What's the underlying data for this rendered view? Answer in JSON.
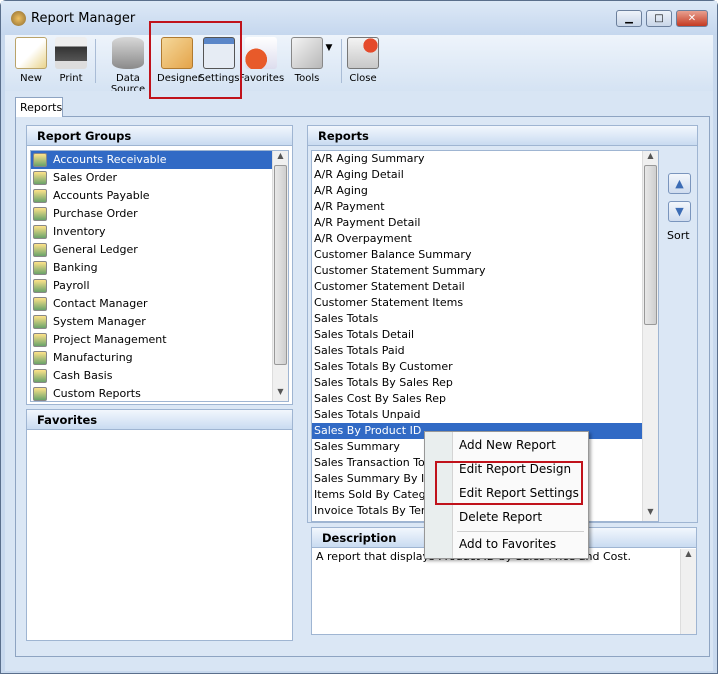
{
  "window": {
    "title": "Report Manager",
    "minimize": "▁",
    "maximize": "□",
    "close": "✕"
  },
  "toolbar": [
    {
      "label": "New",
      "icon": "new-report-icon"
    },
    {
      "label": "Print",
      "icon": "printer-icon"
    },
    {
      "label": "Data Source",
      "icon": "database-icon"
    },
    {
      "label": "Designer",
      "icon": "designer-icon"
    },
    {
      "label": "Settings",
      "icon": "settings-icon"
    },
    {
      "label": "Favorites",
      "icon": "favorites-icon"
    },
    {
      "label": "Tools",
      "icon": "tools-icon"
    },
    {
      "label": "Close",
      "icon": "close-report-icon"
    }
  ],
  "tabs": {
    "reports": "Reports"
  },
  "report_groups": {
    "title": "Report Groups",
    "items": [
      "Accounts Receivable",
      "Sales Order",
      "Accounts Payable",
      "Purchase Order",
      "Inventory",
      "General Ledger",
      "Banking",
      "Payroll",
      "Contact Manager",
      "System Manager",
      "Project Management",
      "Manufacturing",
      "Cash Basis",
      "Custom Reports"
    ],
    "selected": "Accounts Receivable"
  },
  "favorites": {
    "title": "Favorites"
  },
  "reports": {
    "title": "Reports",
    "items": [
      "A/R Aging Summary",
      "A/R Aging Detail",
      "A/R Aging",
      "A/R Payment",
      "A/R Payment Detail",
      "A/R Overpayment",
      "Customer Balance Summary",
      "Customer Statement Summary",
      "Customer Statement Detail",
      "Customer Statement Items",
      "Sales Totals",
      "Sales Totals Detail",
      "Sales Totals Paid",
      "Sales Totals By Customer",
      "Sales Totals By Sales Rep",
      "Sales Cost By Sales Rep",
      "Sales Totals Unpaid",
      "Sales By Product ID",
      "Sales Summary",
      "Sales Transaction Totals",
      "Sales Summary By Item",
      "Items Sold By Category",
      "Invoice Totals By Terms"
    ],
    "selected": "Sales By Product ID",
    "sort_label": "Sort"
  },
  "description": {
    "title": "Description",
    "text": "A report that displays Product ID by Sales Price and Cost."
  },
  "context_menu": [
    "Add New Report",
    "Edit Report Design",
    "Edit Report Settings",
    "Delete Report",
    "Add to Favorites"
  ],
  "colors": {
    "selection": "#316ac5",
    "highlight_box": "#c0121b"
  }
}
